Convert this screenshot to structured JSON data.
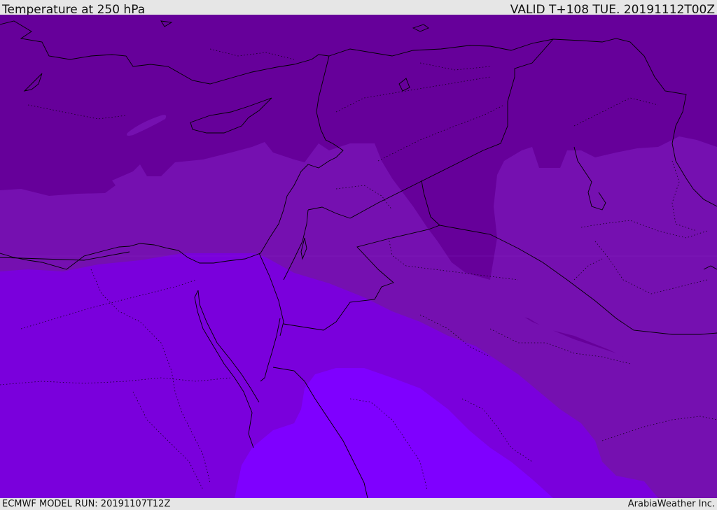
{
  "header": {
    "title": "Temperature at 250 hPa",
    "valid_time": "VALID T+108 TUE. 20191112T00Z"
  },
  "footer": {
    "model_run": "ECMWF MODEL RUN: 20191107T12Z",
    "credit": "ArabiaWeather Inc."
  },
  "map": {
    "field": "temperature",
    "level": "250 hPa",
    "colors": {
      "coldest": "#66009a",
      "cold": "#7510b0",
      "mild": "#7a00dc",
      "warm": "#7f00ff",
      "lines": "#000000"
    }
  }
}
